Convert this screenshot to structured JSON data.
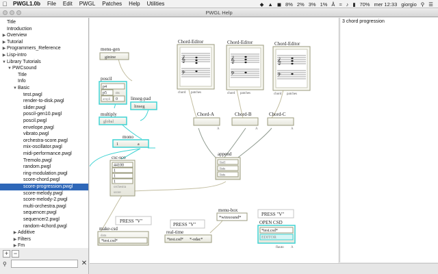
{
  "menubar": {
    "app_name": "PWGL1.0b",
    "items": [
      "File",
      "Edit",
      "PWGL",
      "Patches",
      "Help",
      "Utilities"
    ],
    "status": {
      "battery_icon_pct": "8%",
      "cpu1": "2%",
      "cpu2": "3%",
      "cpu3": "1%",
      "battery": "70%",
      "day_time": "mer 12:33",
      "user": "giorgio"
    }
  },
  "window": {
    "title": "PWGL Help"
  },
  "tree": [
    {
      "label": "Title",
      "indent": 0,
      "arrow": ""
    },
    {
      "label": "Introduction",
      "indent": 0,
      "arrow": ""
    },
    {
      "label": "Overview",
      "indent": 0,
      "arrow": "▶"
    },
    {
      "label": "Tutorial",
      "indent": 0,
      "arrow": "▶"
    },
    {
      "label": "Programmers_Reference",
      "indent": 0,
      "arrow": "▶"
    },
    {
      "label": "Lisp-intro",
      "indent": 0,
      "arrow": "▶"
    },
    {
      "label": "Library Tutorials",
      "indent": 0,
      "arrow": "▼"
    },
    {
      "label": "PWCsound",
      "indent": 1,
      "arrow": "▼"
    },
    {
      "label": "Title",
      "indent": 2,
      "arrow": ""
    },
    {
      "label": "Info",
      "indent": 2,
      "arrow": ""
    },
    {
      "label": "Basic",
      "indent": 2,
      "arrow": "▼"
    },
    {
      "label": "test.pwgl",
      "indent": 3,
      "arrow": ""
    },
    {
      "label": "render-to-disk.pwgl",
      "indent": 3,
      "arrow": ""
    },
    {
      "label": "slider.pwgl",
      "indent": 3,
      "arrow": ""
    },
    {
      "label": "poscil-gen10.pwgl",
      "indent": 3,
      "arrow": ""
    },
    {
      "label": "poscil.pwgl",
      "indent": 3,
      "arrow": ""
    },
    {
      "label": "envelope.pwgl",
      "indent": 3,
      "arrow": ""
    },
    {
      "label": "vibrato.pwgl",
      "indent": 3,
      "arrow": ""
    },
    {
      "label": "orchestra-score.pwgl",
      "indent": 3,
      "arrow": ""
    },
    {
      "label": "mix-oscillator.pwgl",
      "indent": 3,
      "arrow": ""
    },
    {
      "label": "midi-performance.pwgl",
      "indent": 3,
      "arrow": ""
    },
    {
      "label": "Tremolo.pwgl",
      "indent": 3,
      "arrow": ""
    },
    {
      "label": "random.pwgl",
      "indent": 3,
      "arrow": ""
    },
    {
      "label": "ring-modulation.pwgl",
      "indent": 3,
      "arrow": ""
    },
    {
      "label": "score-chord.pwgl",
      "indent": 3,
      "arrow": ""
    },
    {
      "label": "score-progression.pwgl",
      "indent": 3,
      "arrow": "",
      "selected": true
    },
    {
      "label": "score-melody.pwgl",
      "indent": 3,
      "arrow": ""
    },
    {
      "label": "score-melody-2.pwgl",
      "indent": 3,
      "arrow": ""
    },
    {
      "label": "multi-orchestra.pwgl",
      "indent": 3,
      "arrow": ""
    },
    {
      "label": "sequencer.pwgl",
      "indent": 3,
      "arrow": ""
    },
    {
      "label": "sequencer2.pwgl",
      "indent": 3,
      "arrow": ""
    },
    {
      "label": "random-4chord.pwgl",
      "indent": 3,
      "arrow": ""
    },
    {
      "label": "Additive",
      "indent": 2,
      "arrow": "▶"
    },
    {
      "label": "Filters",
      "indent": 2,
      "arrow": "▶"
    },
    {
      "label": "Fm",
      "indent": 2,
      "arrow": "▶"
    }
  ],
  "sidebar_controls": {
    "add": "+",
    "remove": "−",
    "clear": "✕"
  },
  "patch": {
    "menu_gen": {
      "title": "menu-gen",
      "value": "ginine"
    },
    "poscil": {
      "title": "poscil",
      "rows": [
        "p4",
        "p5",
        "ampli"
      ],
      "row2_extra": "cts",
      "row3_extra": "0"
    },
    "linseg_pad": {
      "title": "linseg-pad",
      "value": "linseg"
    },
    "multiply": {
      "title": "multiply",
      "value": "global"
    },
    "mono": {
      "title": "mono",
      "left": "1",
      "right": "a"
    },
    "csc_sco": {
      "title": "csc-sco",
      "rows": [
        "44100",
        "1",
        "1",
        "1",
        "orchestra",
        "score"
      ]
    },
    "chord_editors": [
      {
        "title": "Chord-Editor",
        "ports": [
          "chord",
          "patches"
        ]
      },
      {
        "title": "Chord-Editor",
        "ports": [
          "chord",
          "patches"
        ]
      },
      {
        "title": "Chord-Editor",
        "ports": [
          "chord",
          "patches"
        ]
      }
    ],
    "chord_a": "Chord-A",
    "chord_b": "Chord-B",
    "chord_c": "Chord-C",
    "append": {
      "title": "append",
      "rows": [
        "list1",
        "lists",
        "lists"
      ]
    },
    "press_v": "PRESS \"V\"",
    "make_csd": {
      "title": "make-csd",
      "rows": [
        "data",
        "*test.csd*"
      ]
    },
    "real_time": {
      "title": "real-time",
      "left": "*test.csd*",
      "right": "*-odac*"
    },
    "menu_box": {
      "title": "menu-box",
      "value": "*winxound*"
    },
    "open_csd": {
      "title": "OPEN CSD",
      "rows": [
        "*test.csd*",
        "EDITOR"
      ],
      "port": "flauto"
    },
    "port_a": "A"
  },
  "help_panel": {
    "text": "3 chord progression"
  },
  "colors": {
    "selection": "#2e67b8",
    "box_border": "#9a9a7c",
    "cyan": "#3fd3d3",
    "wire": "#8f9a8f"
  }
}
